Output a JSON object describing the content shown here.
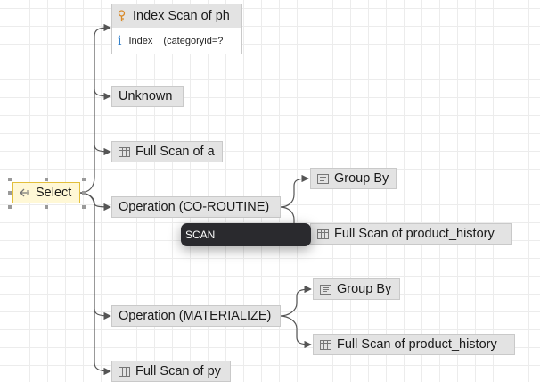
{
  "root": {
    "label": "Select",
    "icon": "arrow-left-icon"
  },
  "index_card": {
    "title": "Index Scan of ph",
    "icon": "key-icon",
    "detail_icon": "info-icon",
    "detail_key": "Index",
    "detail_value": "(categoryid=?"
  },
  "nodes": {
    "unknown": "Unknown",
    "full_scan_a": "Full Scan of a",
    "co_routine": "Operation (CO-ROUTINE)",
    "group_by_1": "Group By",
    "full_scan_ph_1": "Full Scan of product_history",
    "materialize": "Operation (MATERIALIZE)",
    "group_by_2": "Group By",
    "full_scan_ph_2": "Full Scan of product_history",
    "full_scan_py": "Full Scan of py"
  },
  "tooltip": {
    "text": "SCAN"
  },
  "colors": {
    "node_bg": "#e3e3e3",
    "selected_bg": "#fff8d6",
    "selected_border": "#e2bf3c",
    "edge": "#555555",
    "info_icon": "#2d7cc9",
    "key_icon": "#d88a2a",
    "tooltip_bg": "#2a2a2e"
  }
}
